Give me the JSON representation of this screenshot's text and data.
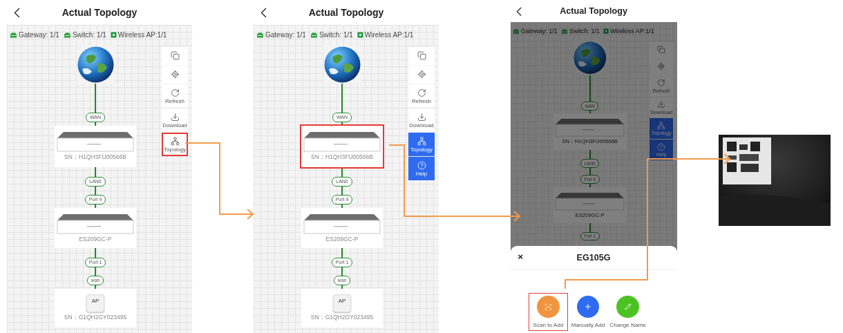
{
  "panels": [
    {
      "kind": "phone",
      "title": "Actual Topology",
      "legend": [
        {
          "kind": "gateway",
          "text": "Gateway: 1/1"
        },
        {
          "kind": "switch",
          "text": "Switch: 1/1"
        },
        {
          "kind": "ap",
          "text": "Wireless AP:1/1"
        }
      ],
      "toolbar": [
        {
          "kind": "screen",
          "selected": false,
          "highlighted": false
        },
        {
          "kind": "locate",
          "selected": false,
          "highlighted": false
        },
        {
          "kind": "refresh",
          "label": "Refresh",
          "selected": false,
          "highlighted": false
        },
        {
          "kind": "download",
          "label": "Download",
          "selected": false,
          "highlighted": false
        },
        {
          "kind": "topology",
          "label": "Topology",
          "selected": false,
          "highlighted": true
        }
      ],
      "nodes": [
        {
          "kind": "globe"
        },
        {
          "kind": "pill",
          "text": "WAN"
        },
        {
          "kind": "switch",
          "caption": "SN：H1QH3FU00566B",
          "highlighted": false
        },
        {
          "kind": "pill",
          "text": "LAN0"
        },
        {
          "kind": "pill",
          "text": "Port 9"
        },
        {
          "kind": "switch",
          "caption": "ES209GC-P",
          "highlighted": false
        },
        {
          "kind": "pill",
          "text": "Port 1"
        },
        {
          "kind": "pill",
          "text": "wan"
        },
        {
          "kind": "ap",
          "badge": "AP",
          "caption": "SN：G1QH2GY023495",
          "highlighted": false
        }
      ]
    },
    {
      "kind": "phone",
      "title": "Actual Topology",
      "legend": [
        {
          "kind": "gateway",
          "text": "Gateway: 1/1"
        },
        {
          "kind": "switch",
          "text": "Switch: 1/1"
        },
        {
          "kind": "ap",
          "text": "Wireless AP:1/1"
        }
      ],
      "toolbar": [
        {
          "kind": "screen",
          "selected": false,
          "highlighted": false
        },
        {
          "kind": "locate",
          "selected": false,
          "highlighted": false
        },
        {
          "kind": "refresh",
          "label": "Refresh",
          "selected": false,
          "highlighted": false
        },
        {
          "kind": "download",
          "label": "Download",
          "selected": false,
          "highlighted": false
        },
        {
          "kind": "topology",
          "label": "Topology",
          "selected": true,
          "highlighted": false
        },
        {
          "kind": "help",
          "label": "Help",
          "selected": true,
          "highlighted": false
        }
      ],
      "nodes": [
        {
          "kind": "globe"
        },
        {
          "kind": "pill",
          "text": "WAN"
        },
        {
          "kind": "switch",
          "caption": "SN：H1QH3FU00566B",
          "highlighted": true
        },
        {
          "kind": "pill",
          "text": "LAN0"
        },
        {
          "kind": "pill",
          "text": "Port 9"
        },
        {
          "kind": "switch",
          "caption": "ES209GC-P",
          "highlighted": false
        },
        {
          "kind": "pill",
          "text": "Port 1"
        },
        {
          "kind": "pill",
          "text": "wan"
        },
        {
          "kind": "ap",
          "badge": "AP",
          "caption": "SN：G1QH2GY023495",
          "highlighted": false
        }
      ]
    },
    {
      "kind": "phone",
      "title": "Actual Topology",
      "dimmed": true,
      "legend": [
        {
          "kind": "gateway",
          "text": "Gateway: 1/1"
        },
        {
          "kind": "switch",
          "text": "Switch: 1/1"
        },
        {
          "kind": "ap",
          "text": "Wireless AP:1/1"
        }
      ],
      "toolbar": [
        {
          "kind": "screen",
          "selected": false,
          "highlighted": false
        },
        {
          "kind": "locate",
          "selected": false,
          "highlighted": false
        },
        {
          "kind": "refresh",
          "label": "Refresh",
          "selected": false,
          "highlighted": false
        },
        {
          "kind": "download",
          "label": "Download",
          "selected": false,
          "highlighted": false
        },
        {
          "kind": "topology",
          "label": "Topology",
          "selected": true,
          "highlighted": false
        },
        {
          "kind": "help",
          "label": "Help",
          "selected": true,
          "highlighted": false
        }
      ],
      "nodes": [
        {
          "kind": "globe"
        },
        {
          "kind": "pill",
          "text": "WAN"
        },
        {
          "kind": "switch",
          "caption": "SN：H1QH3FU00566B",
          "highlighted": false
        },
        {
          "kind": "pill",
          "text": "LAN0"
        },
        {
          "kind": "pill",
          "text": "Port 9"
        },
        {
          "kind": "switch",
          "caption": "ES209GC-P",
          "highlighted": false
        },
        {
          "kind": "pill",
          "text": "Port 1"
        }
      ],
      "sheet": {
        "close": "×",
        "title": "EG105G",
        "actions": [
          {
            "kind": "scan",
            "label": "Scan to Add",
            "color": "#f0953e",
            "highlighted": true
          },
          {
            "kind": "add",
            "label": "Manually Add",
            "color": "#2f6bf0",
            "highlighted": false
          },
          {
            "kind": "rename",
            "label": "Change Name",
            "color": "#4cc323",
            "highlighted": false
          }
        ]
      }
    }
  ]
}
